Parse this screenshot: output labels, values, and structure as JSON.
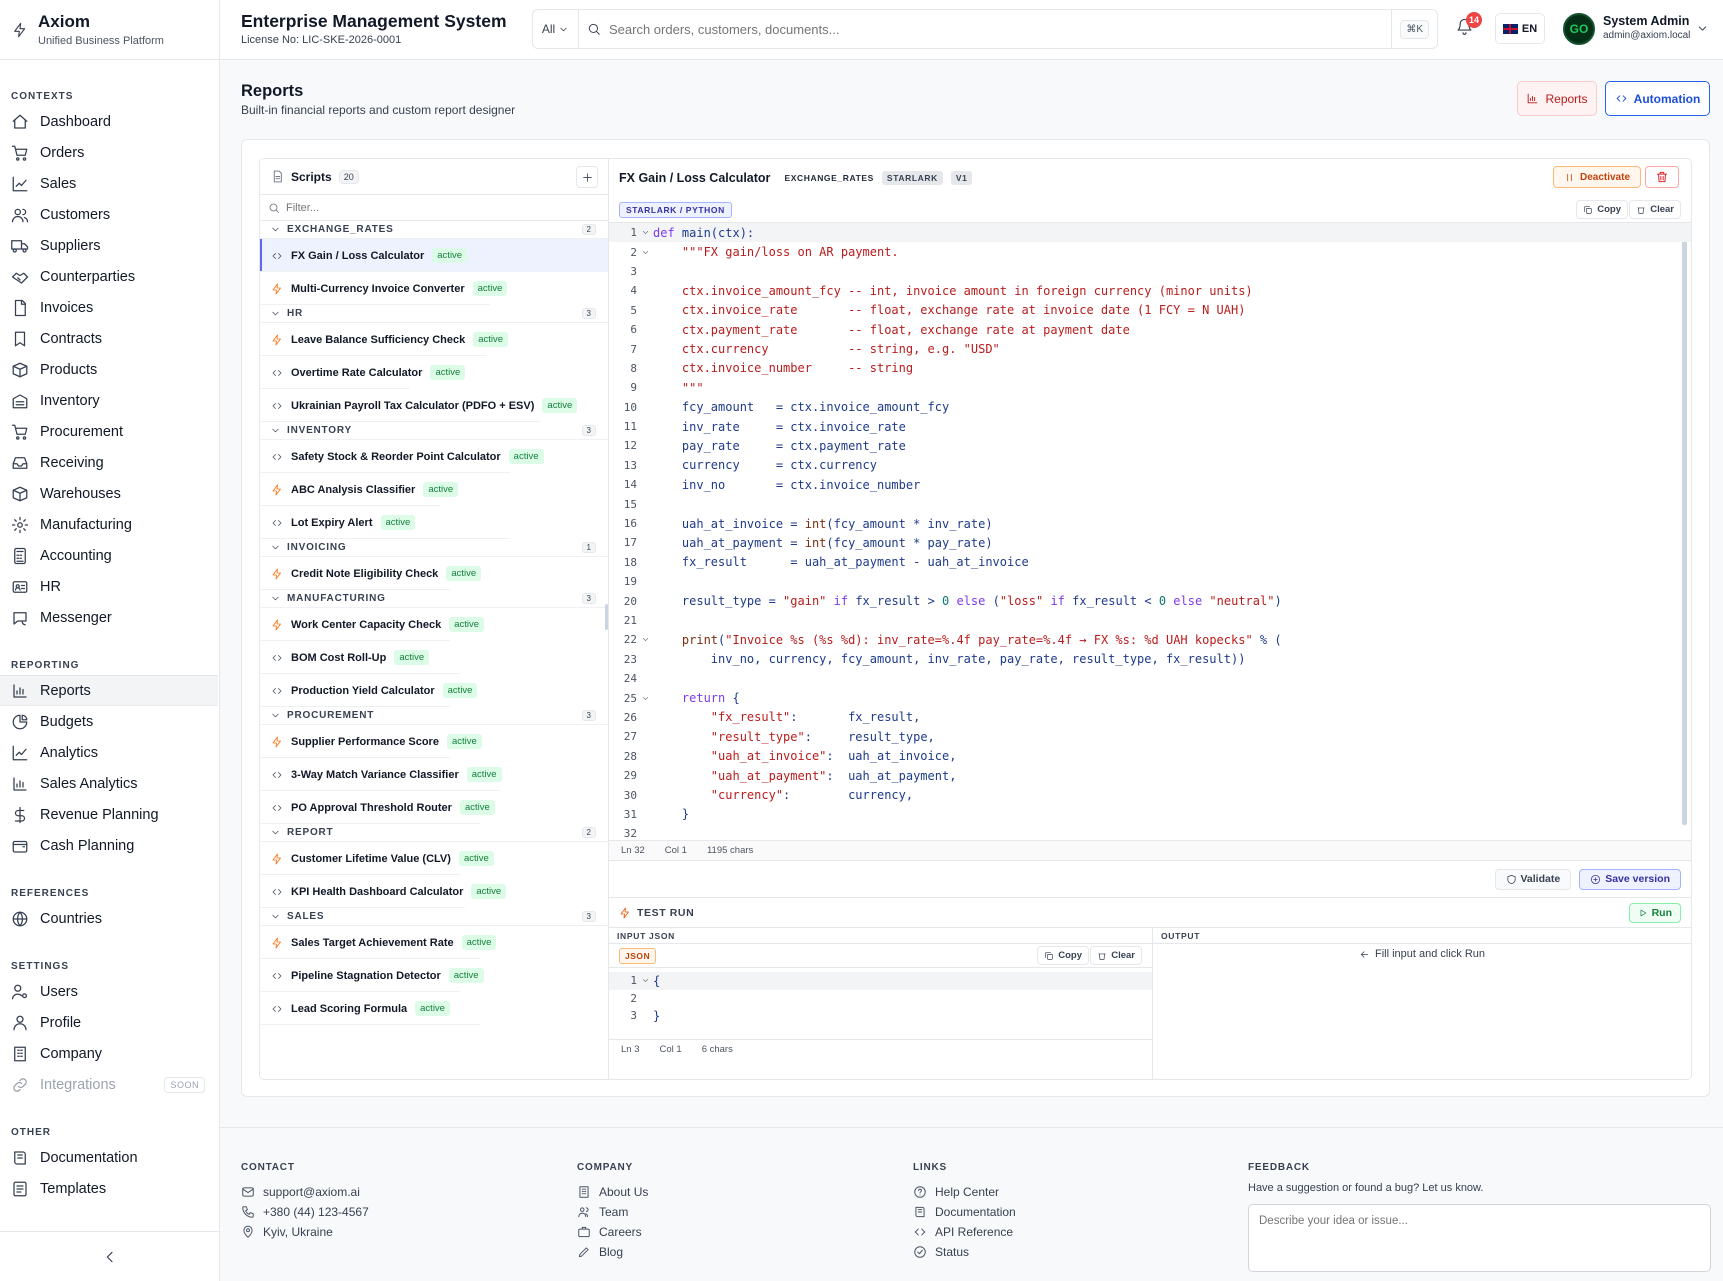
{
  "brand": {
    "name": "Axiom",
    "tagline": "Unified Business Platform"
  },
  "header": {
    "title": "Enterprise Management System",
    "license": "License No: LIC-SKE-2026-0001",
    "search_scope": "All",
    "search_placeholder": "Search orders, customers, documents...",
    "shortcut": "⌘K",
    "notifications": "14",
    "language": "EN",
    "user": {
      "name": "System Admin",
      "email": "admin@axiom.local",
      "avatar": "GO"
    }
  },
  "sidebar": {
    "sections": [
      {
        "title": "CONTEXTS",
        "items": [
          {
            "label": "Dashboard",
            "icon": "home-icon"
          },
          {
            "label": "Orders",
            "icon": "cart-icon"
          },
          {
            "label": "Sales",
            "icon": "trend-icon"
          },
          {
            "label": "Customers",
            "icon": "users-icon"
          },
          {
            "label": "Suppliers",
            "icon": "truck-icon"
          },
          {
            "label": "Counterparties",
            "icon": "handshake-icon"
          },
          {
            "label": "Invoices",
            "icon": "file-icon"
          },
          {
            "label": "Contracts",
            "icon": "bookmark-icon"
          },
          {
            "label": "Products",
            "icon": "box-icon"
          },
          {
            "label": "Inventory",
            "icon": "warehouse-icon"
          },
          {
            "label": "Procurement",
            "icon": "cart-icon"
          },
          {
            "label": "Receiving",
            "icon": "inbox-icon"
          },
          {
            "label": "Warehouses",
            "icon": "box-icon"
          },
          {
            "label": "Manufacturing",
            "icon": "gear-icon"
          },
          {
            "label": "Accounting",
            "icon": "calculator-icon"
          },
          {
            "label": "HR",
            "icon": "id-card-icon"
          },
          {
            "label": "Messenger",
            "icon": "chat-icon"
          }
        ]
      },
      {
        "title": "REPORTING",
        "items": [
          {
            "label": "Reports",
            "icon": "bar-chart-icon",
            "active": true
          },
          {
            "label": "Budgets",
            "icon": "pie-icon"
          },
          {
            "label": "Analytics",
            "icon": "trend-icon"
          },
          {
            "label": "Sales Analytics",
            "icon": "bar-chart-icon"
          },
          {
            "label": "Revenue Planning",
            "icon": "dollar-icon"
          },
          {
            "label": "Cash Planning",
            "icon": "wallet-icon"
          }
        ]
      },
      {
        "title": "REFERENCES",
        "items": [
          {
            "label": "Countries",
            "icon": "globe-icon"
          }
        ]
      },
      {
        "title": "SETTINGS",
        "items": [
          {
            "label": "Users",
            "icon": "user-cog-icon"
          },
          {
            "label": "Profile",
            "icon": "user-icon"
          },
          {
            "label": "Company",
            "icon": "building-icon"
          },
          {
            "label": "Integrations",
            "icon": "link-icon",
            "disabled": true,
            "badge": "SOON"
          }
        ]
      },
      {
        "title": "OTHER",
        "items": [
          {
            "label": "Documentation",
            "icon": "book-icon"
          },
          {
            "label": "Templates",
            "icon": "template-icon"
          }
        ]
      }
    ]
  },
  "page": {
    "title": "Reports",
    "subtitle": "Built-in financial reports and custom report designer",
    "tab_reports": "Reports",
    "tab_automation": "Automation"
  },
  "scripts": {
    "title": "Scripts",
    "count": "20",
    "filter_placeholder": "Filter...",
    "groups": [
      {
        "name": "EXCHANGE_RATES",
        "count": "2",
        "items": [
          {
            "name": "FX Gain / Loss Calculator",
            "kind": "code",
            "status": "active",
            "selected": true
          },
          {
            "name": "Multi-Currency Invoice Converter",
            "kind": "bolt",
            "status": "active"
          }
        ]
      },
      {
        "name": "HR",
        "count": "3",
        "items": [
          {
            "name": "Leave Balance Sufficiency Check",
            "kind": "bolt",
            "status": "active"
          },
          {
            "name": "Overtime Rate Calculator",
            "kind": "code",
            "status": "active"
          },
          {
            "name": "Ukrainian Payroll Tax Calculator (PDFO + ESV)",
            "kind": "code",
            "status": "active"
          }
        ]
      },
      {
        "name": "INVENTORY",
        "count": "3",
        "items": [
          {
            "name": "Safety Stock & Reorder Point Calculator",
            "kind": "code",
            "status": "active"
          },
          {
            "name": "ABC Analysis Classifier",
            "kind": "bolt",
            "status": "active"
          },
          {
            "name": "Lot Expiry Alert",
            "kind": "code",
            "status": "active"
          }
        ]
      },
      {
        "name": "INVOICING",
        "count": "1",
        "items": [
          {
            "name": "Credit Note Eligibility Check",
            "kind": "bolt",
            "status": "active"
          }
        ]
      },
      {
        "name": "MANUFACTURING",
        "count": "3",
        "items": [
          {
            "name": "Work Center Capacity Check",
            "kind": "bolt",
            "status": "active"
          },
          {
            "name": "BOM Cost Roll-Up",
            "kind": "code",
            "status": "active"
          },
          {
            "name": "Production Yield Calculator",
            "kind": "code",
            "status": "active"
          }
        ]
      },
      {
        "name": "PROCUREMENT",
        "count": "3",
        "items": [
          {
            "name": "Supplier Performance Score",
            "kind": "bolt",
            "status": "active"
          },
          {
            "name": "3-Way Match Variance Classifier",
            "kind": "code",
            "status": "active"
          },
          {
            "name": "PO Approval Threshold Router",
            "kind": "code",
            "status": "active"
          }
        ]
      },
      {
        "name": "REPORT",
        "count": "2",
        "items": [
          {
            "name": "Customer Lifetime Value (CLV)",
            "kind": "bolt",
            "status": "active"
          },
          {
            "name": "KPI Health Dashboard Calculator",
            "kind": "code",
            "status": "active"
          }
        ]
      },
      {
        "name": "SALES",
        "count": "3",
        "items": [
          {
            "name": "Sales Target Achievement Rate",
            "kind": "bolt",
            "status": "active"
          },
          {
            "name": "Pipeline Stagnation Detector",
            "kind": "code",
            "status": "active"
          },
          {
            "name": "Lead Scoring Formula",
            "kind": "code",
            "status": "active"
          }
        ]
      }
    ]
  },
  "editor": {
    "title": "FX Gain / Loss Calculator",
    "category": "EXCHANGE_RATES",
    "engine": "STARLARK",
    "version": "V1",
    "deactivate": "Deactivate",
    "language": "STARLARK / PYTHON",
    "copy": "Copy",
    "clear": "Clear",
    "code": [
      "def main(ctx):",
      "    \"\"\"FX gain/loss on AR payment.",
      "",
      "    ctx.invoice_amount_fcy -- int, invoice amount in foreign currency (minor units)",
      "    ctx.invoice_rate       -- float, exchange rate at invoice date (1 FCY = N UAH)",
      "    ctx.payment_rate       -- float, exchange rate at payment date",
      "    ctx.currency           -- string, e.g. \"USD\"",
      "    ctx.invoice_number     -- string",
      "    \"\"\"",
      "    fcy_amount   = ctx.invoice_amount_fcy",
      "    inv_rate     = ctx.invoice_rate",
      "    pay_rate     = ctx.payment_rate",
      "    currency     = ctx.currency",
      "    inv_no       = ctx.invoice_number",
      "",
      "    uah_at_invoice = int(fcy_amount * inv_rate)",
      "    uah_at_payment = int(fcy_amount * pay_rate)",
      "    fx_result      = uah_at_payment - uah_at_invoice",
      "",
      "    result_type = \"gain\" if fx_result > 0 else (\"loss\" if fx_result < 0 else \"neutral\")",
      "",
      "    print(\"Invoice %s (%s %d): inv_rate=%.4f pay_rate=%.4f → FX %s: %d UAH kopecks\" % (",
      "        inv_no, currency, fcy_amount, inv_rate, pay_rate, result_type, fx_result))",
      "",
      "    return {",
      "        \"fx_result\":       fx_result,",
      "        \"result_type\":     result_type,",
      "        \"uah_at_invoice\":  uah_at_invoice,",
      "        \"uah_at_payment\":  uah_at_payment,",
      "        \"currency\":        currency,",
      "    }",
      ""
    ],
    "status": {
      "line": "Ln 32",
      "col": "Col 1",
      "chars": "1195 chars"
    },
    "validate": "Validate",
    "save": "Save version"
  },
  "test_run": {
    "title": "TEST RUN",
    "run": "Run",
    "input_label": "INPUT JSON",
    "output_label": "OUTPUT",
    "json_chip": "JSON",
    "input_lines": [
      "{",
      "",
      "}"
    ],
    "status": {
      "line": "Ln 3",
      "col": "Col 1",
      "chars": "6 chars"
    },
    "output_hint": "Fill input and click Run"
  },
  "footer": {
    "contact": {
      "title": "CONTACT",
      "email": "support@axiom.ai",
      "phone": "+380 (44) 123-4567",
      "location": "Kyiv, Ukraine"
    },
    "company": {
      "title": "COMPANY",
      "links": [
        "About Us",
        "Team",
        "Careers",
        "Blog"
      ]
    },
    "links": {
      "title": "LINKS",
      "links": [
        "Help Center",
        "Documentation",
        "API Reference",
        "Status"
      ]
    },
    "feedback": {
      "title": "FEEDBACK",
      "text": "Have a suggestion or found a bug? Let us know.",
      "placeholder": "Describe your idea or issue..."
    }
  }
}
